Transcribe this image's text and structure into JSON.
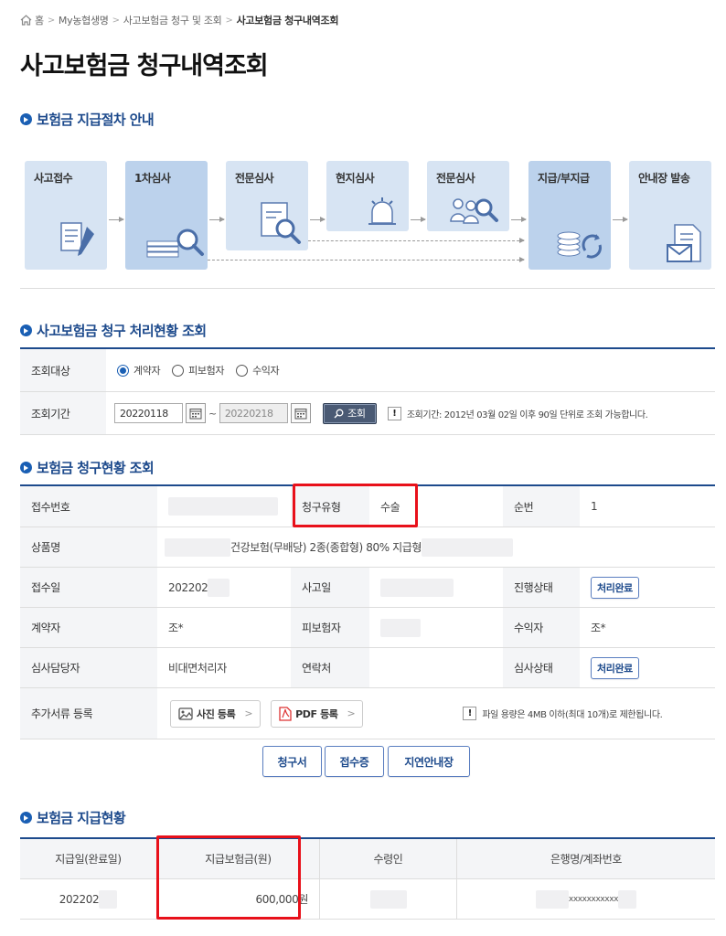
{
  "breadcrumb": {
    "home": "홈",
    "items": [
      "My농협생명",
      "사고보험금 청구 및 조회"
    ],
    "current": "사고보험금 청구내역조회"
  },
  "page_title": "사고보험금 청구내역조회",
  "section_process": {
    "title": "보험금 지급절차 안내",
    "steps": [
      "사고접수",
      "1차심사",
      "전문심사",
      "현지심사",
      "전문심사",
      "지급/부지급",
      "안내장 발송"
    ]
  },
  "section_status": {
    "title": "사고보험금 청구 처리현황 조회",
    "target_label": "조회대상",
    "radio_options": [
      "계약자",
      "피보험자",
      "수익자"
    ],
    "selected_option": "계약자",
    "period_label": "조회기간",
    "date_from": "20220118",
    "date_to": "20220218",
    "tilde": "~",
    "search_button": "조회",
    "notice": "조회기간: 2012년 03월 02일 이후 90일 단위로 조회 가능합니다."
  },
  "section_claim": {
    "title": "보험금 청구현황 조회",
    "labels": {
      "receipt_no": "접수번호",
      "claim_type": "청구유형",
      "seq": "순번",
      "product": "상품명",
      "receipt_date": "접수일",
      "accident_date": "사고일",
      "progress": "진행상태",
      "contractor": "계약자",
      "insured": "피보험자",
      "beneficiary": "수익자",
      "reviewer": "심사담당자",
      "contact": "연락처",
      "review_status": "심사상태",
      "additional_docs": "추가서류 등록"
    },
    "values": {
      "claim_type": "수술",
      "seq": "1",
      "product": "건강보험(무배당) 2종(종합형) 80% 지급형",
      "receipt_date": "202202",
      "progress": "처리완료",
      "contractor": "조*",
      "beneficiary": "조*",
      "reviewer": "비대면처리자",
      "review_status": "처리완료"
    },
    "photo_button": "사진 등록",
    "pdf_button": "PDF 등록",
    "file_notice": "파일 용량은 4MB 이하(최대 10개)로 제한됩니다.",
    "actions": [
      "청구서",
      "접수증",
      "지연안내장"
    ]
  },
  "section_payment": {
    "title": "보험금 지급현황",
    "columns": [
      "지급일(완료일)",
      "지급보험금(원)",
      "수령인",
      "은행명/계좌번호"
    ],
    "rows": [
      {
        "date": "202202",
        "amount": "600,000원",
        "account": "xxxxxxxxxxx"
      }
    ]
  },
  "colors": {
    "accent": "#1d4a8c",
    "highlight": "#e8101a",
    "step_bg": "#d7e4f3"
  }
}
